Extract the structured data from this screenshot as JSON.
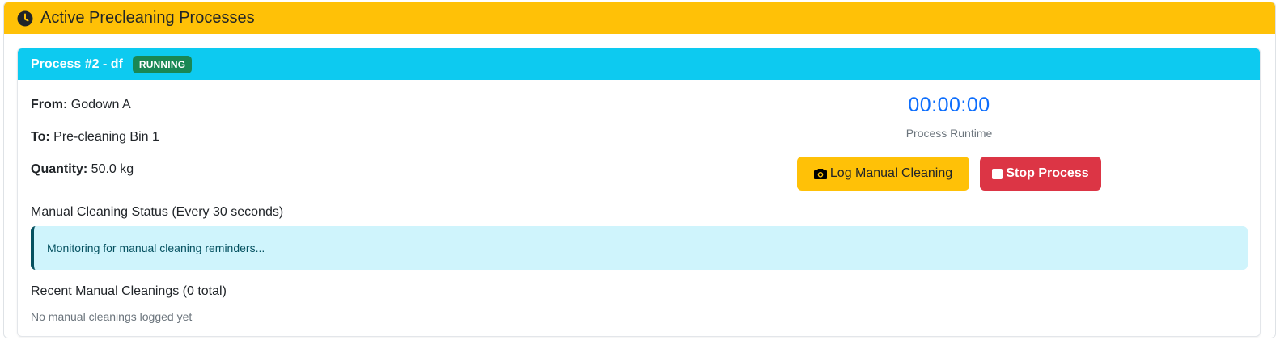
{
  "panel": {
    "title": "Active Precleaning Processes",
    "icon": "clock-icon"
  },
  "process": {
    "title": "Process #2 - df",
    "status": "RUNNING",
    "status_color": "#198754",
    "header_color": "#0dcaf0",
    "from_label": "From:",
    "from_value": "Godown A",
    "to_label": "To:",
    "to_value": "Pre-cleaning Bin 1",
    "quantity_label": "Quantity:",
    "quantity_value": "50.0 kg",
    "timer": "00:00:00",
    "timer_label": "Process Runtime",
    "log_button": "Log Manual Cleaning",
    "log_button_icon": "camera-icon",
    "stop_button": "Stop Process",
    "stop_button_icon": "stop-icon",
    "cleaning_status_title": "Manual Cleaning Status (Every 30 seconds)",
    "cleaning_status_message": "Monitoring for manual cleaning reminders...",
    "recent_title": "Recent Manual Cleanings (0 total)",
    "recent_empty": "No manual cleanings logged yet"
  },
  "colors": {
    "header": "#ffc107",
    "warning_button": "#ffc107",
    "danger_button": "#dc3545",
    "timer_text": "#0d6efd",
    "alert_bg": "#cff4fc"
  }
}
